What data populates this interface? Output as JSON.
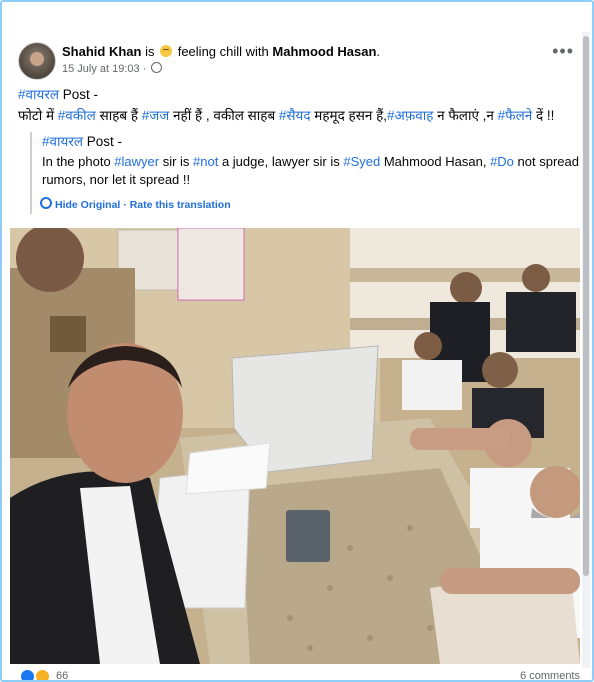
{
  "post": {
    "author": "Shahid Khan",
    "is": "is",
    "feeling": "feeling chill with",
    "tagged": "Mahmood Hasan",
    "tagged_end": ".",
    "timestamp": "15 July at 19:03",
    "dot": "·",
    "more_icon": "more-dots-icon",
    "privacy_icon": "globe-icon",
    "text": {
      "line1_tag": "#वायरल",
      "line1_rest": " Post -",
      "p1": "फोटो में ",
      "t1": "#वकील",
      "p2": " साहब हैं ",
      "t2": "#जज",
      "p3": " नहीं हैं , वकील साहब ",
      "t3": "#सैयद",
      "p4": " महमूद हसन हैं,",
      "t4": "#अफ़वाह",
      "p5": " न फैलाएं ,न ",
      "t5": "#फैलने",
      "p6": " दें !!"
    }
  },
  "translation": {
    "line1_tag": "#वायरल",
    "line1_rest": " Post -",
    "p1": "In the photo ",
    "t1": "#lawyer",
    "p2": " sir is ",
    "t2": "#not",
    "p3": " a judge, lawyer sir is ",
    "t3": "#Syed",
    "p4": " Mahmood Hasan, ",
    "t4": "#Do",
    "p5": " not spread rumors, nor let it spread !!",
    "hide_label": "Hide Original",
    "sep": " · ",
    "rate_label": "Rate this translation"
  },
  "footer": {
    "reaction_count": "66",
    "comments": "6 comments"
  },
  "colors": {
    "hashtag": "#216fdb",
    "frame_border": "#8ecdf5",
    "meta": "#65676b"
  }
}
